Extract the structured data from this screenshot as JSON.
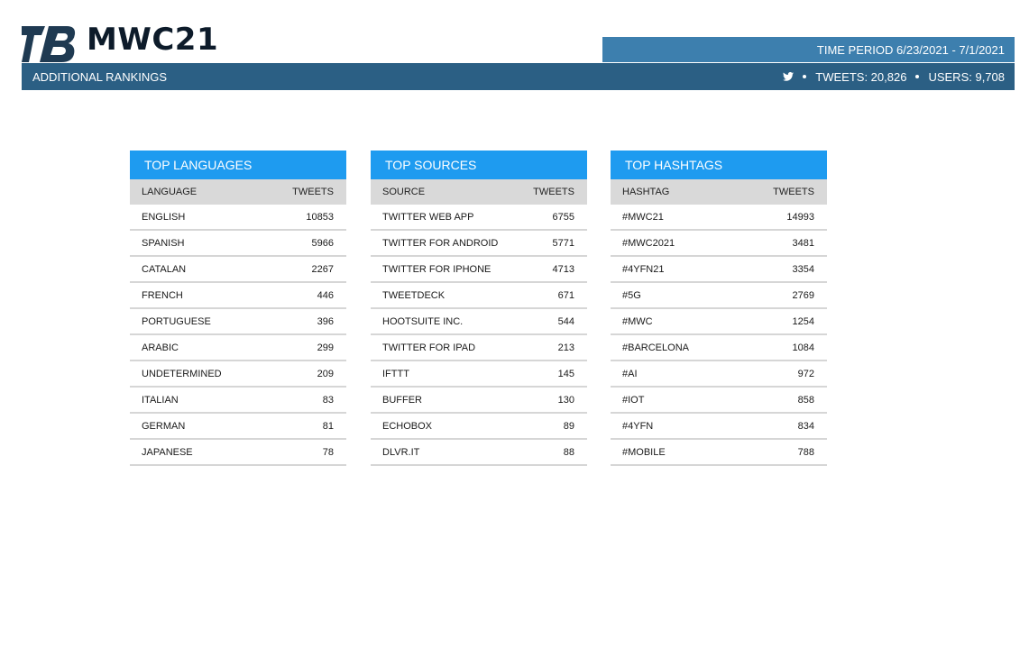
{
  "header": {
    "title": "MWC21",
    "time_period": "TIME PERIOD 6/23/2021 - 7/1/2021",
    "section": "ADDITIONAL RANKINGS",
    "tweets": "TWEETS: 20,826",
    "users": "USERS: 9,708"
  },
  "tables": [
    {
      "title": "TOP LANGUAGES",
      "col1": "LANGUAGE",
      "col2": "TWEETS",
      "rows": [
        {
          "label": "ENGLISH",
          "value": "10853"
        },
        {
          "label": "SPANISH",
          "value": "5966"
        },
        {
          "label": "CATALAN",
          "value": "2267"
        },
        {
          "label": "FRENCH",
          "value": "446"
        },
        {
          "label": "PORTUGUESE",
          "value": "396"
        },
        {
          "label": "ARABIC",
          "value": "299"
        },
        {
          "label": "UNDETERMINED",
          "value": "209"
        },
        {
          "label": "ITALIAN",
          "value": "83"
        },
        {
          "label": "GERMAN",
          "value": "81"
        },
        {
          "label": "JAPANESE",
          "value": "78"
        }
      ]
    },
    {
      "title": "TOP SOURCES",
      "col1": "SOURCE",
      "col2": "TWEETS",
      "rows": [
        {
          "label": "TWITTER WEB APP",
          "value": "6755"
        },
        {
          "label": "TWITTER FOR ANDROID",
          "value": "5771"
        },
        {
          "label": "TWITTER FOR IPHONE",
          "value": "4713"
        },
        {
          "label": "TWEETDECK",
          "value": "671"
        },
        {
          "label": "HOOTSUITE INC.",
          "value": "544"
        },
        {
          "label": "TWITTER FOR IPAD",
          "value": "213"
        },
        {
          "label": "IFTTT",
          "value": "145"
        },
        {
          "label": "BUFFER",
          "value": "130"
        },
        {
          "label": "ECHOBOX",
          "value": "89"
        },
        {
          "label": "DLVR.IT",
          "value": "88"
        }
      ]
    },
    {
      "title": "TOP HASHTAGS",
      "col1": "HASHTAG",
      "col2": "TWEETS",
      "rows": [
        {
          "label": "#MWC21",
          "value": "14993"
        },
        {
          "label": "#MWC2021",
          "value": "3481"
        },
        {
          "label": "#4YFN21",
          "value": "3354"
        },
        {
          "label": "#5G",
          "value": "2769"
        },
        {
          "label": "#MWC",
          "value": "1254"
        },
        {
          "label": "#BARCELONA",
          "value": "1084"
        },
        {
          "label": "#AI",
          "value": "972"
        },
        {
          "label": "#IOT",
          "value": "858"
        },
        {
          "label": "#4YFN",
          "value": "834"
        },
        {
          "label": "#MOBILE",
          "value": "788"
        }
      ]
    }
  ],
  "colors": {
    "accent_blue": "#1e9bf0",
    "bar_dark": "#2b5f84",
    "bar_light": "#3d7fae"
  }
}
